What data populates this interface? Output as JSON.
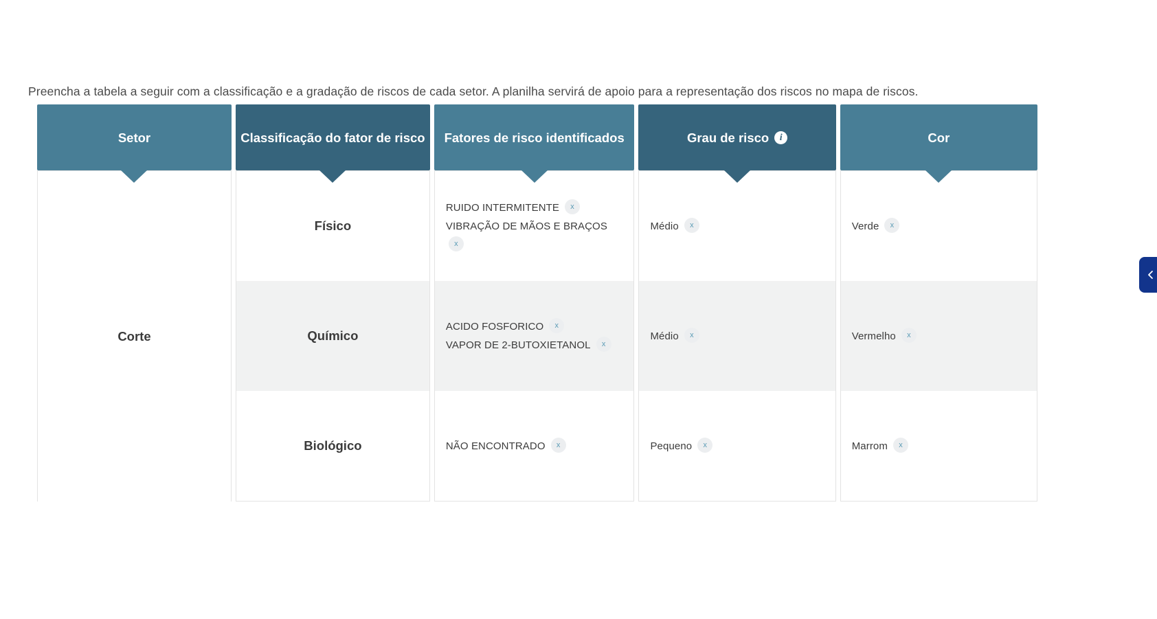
{
  "intro": {
    "text": "Preencha a tabela a seguir com a classificação e a gradação de riscos de cada setor. A planilha servirá de apoio para a representação dos riscos no mapa de riscos."
  },
  "table": {
    "headers": [
      {
        "label": "Setor",
        "shade": "light"
      },
      {
        "label": "Classificação do fator de risco",
        "shade": "dark"
      },
      {
        "label": "Fatores de risco identificados",
        "shade": "light"
      },
      {
        "label": "Grau de risco",
        "shade": "dark",
        "info_icon": "info-icon"
      },
      {
        "label": "Cor",
        "shade": "light"
      }
    ],
    "sector": "Corte",
    "remove_label": "x",
    "rows": [
      {
        "classification": "Físico",
        "factors": [
          "RUIDO INTERMITENTE",
          "VIBRAÇÃO DE MÃOS E BRAÇOS"
        ],
        "degree": [
          "Médio"
        ],
        "color": [
          "Verde"
        ]
      },
      {
        "classification": "Químico",
        "factors": [
          "ACIDO FOSFORICO",
          "VAPOR DE 2-BUTOXIETANOL"
        ],
        "degree": [
          "Médio"
        ],
        "color": [
          "Vermelho"
        ]
      },
      {
        "classification": "Biológico",
        "factors": [
          "NÃO ENCONTRADO"
        ],
        "degree": [
          "Pequeno"
        ],
        "color": [
          "Marrom"
        ]
      }
    ]
  },
  "edge_tab": {
    "icon": "chevron-left-icon",
    "color": "#12348c"
  },
  "colors": {
    "header_light": "#487e96",
    "header_dark": "#36647c",
    "row_alt": "#f1f2f2",
    "tag_x": "#5b9bb5",
    "text": "#3b3b3b"
  }
}
